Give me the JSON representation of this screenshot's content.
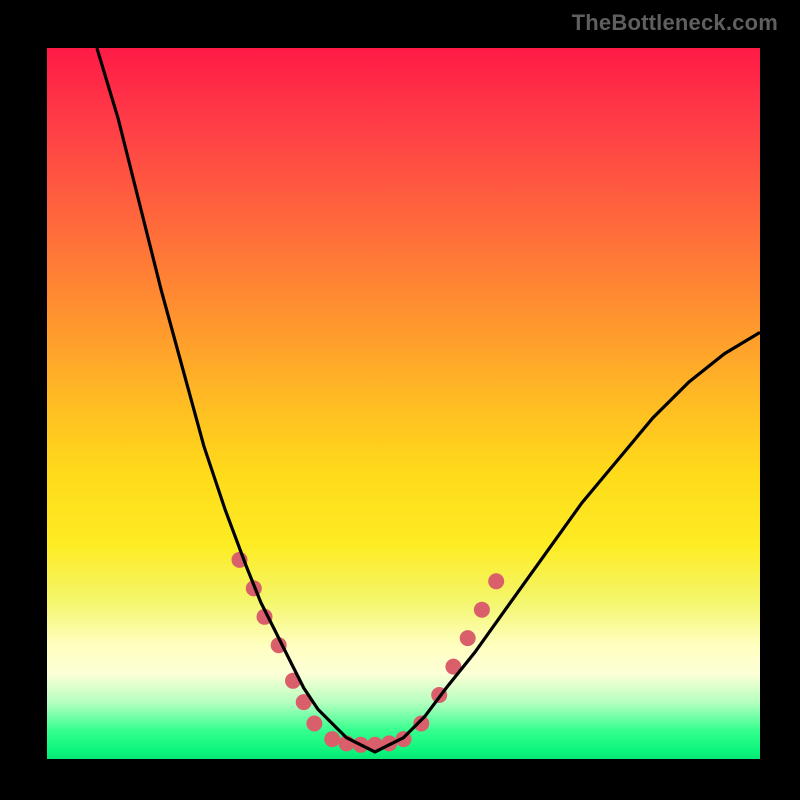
{
  "watermark": {
    "text": "TheBottleneck.com"
  },
  "chart_data": {
    "type": "line",
    "title": "",
    "xlabel": "",
    "ylabel": "",
    "xlim": [
      0,
      100
    ],
    "ylim": [
      0,
      100
    ],
    "grid": false,
    "series": [
      {
        "name": "bottleneck-curve",
        "x": [
          7,
          10,
          13,
          16,
          19,
          22,
          25,
          28,
          30,
          32,
          34,
          36,
          38,
          40,
          42,
          44,
          46,
          48,
          50,
          53,
          56,
          60,
          65,
          70,
          75,
          80,
          85,
          90,
          95,
          100
        ],
        "y": [
          100,
          90,
          78,
          66,
          55,
          44,
          35,
          27,
          22,
          18,
          14,
          10,
          7,
          5,
          3,
          2,
          1,
          2,
          3,
          6,
          10,
          15,
          22,
          29,
          36,
          42,
          48,
          53,
          57,
          60
        ]
      }
    ],
    "markers": {
      "name": "highlight-dots",
      "points": [
        {
          "x": 27,
          "y": 28
        },
        {
          "x": 29,
          "y": 24
        },
        {
          "x": 30.5,
          "y": 20
        },
        {
          "x": 32.5,
          "y": 16
        },
        {
          "x": 34.5,
          "y": 11
        },
        {
          "x": 36,
          "y": 8
        },
        {
          "x": 37.5,
          "y": 5
        },
        {
          "x": 40,
          "y": 2.8
        },
        {
          "x": 42,
          "y": 2.2
        },
        {
          "x": 44,
          "y": 2.0
        },
        {
          "x": 46,
          "y": 2.0
        },
        {
          "x": 48,
          "y": 2.2
        },
        {
          "x": 50,
          "y": 2.8
        },
        {
          "x": 52.5,
          "y": 5
        },
        {
          "x": 55,
          "y": 9
        },
        {
          "x": 57,
          "y": 13
        },
        {
          "x": 59,
          "y": 17
        },
        {
          "x": 61,
          "y": 21
        },
        {
          "x": 63,
          "y": 25
        }
      ],
      "color": "#d9606a",
      "radius_px": 8
    },
    "colors": {
      "background_gradient_top": "#ff1a46",
      "background_gradient_bottom": "#07e673",
      "curve": "#000000",
      "frame": "#000000"
    }
  }
}
